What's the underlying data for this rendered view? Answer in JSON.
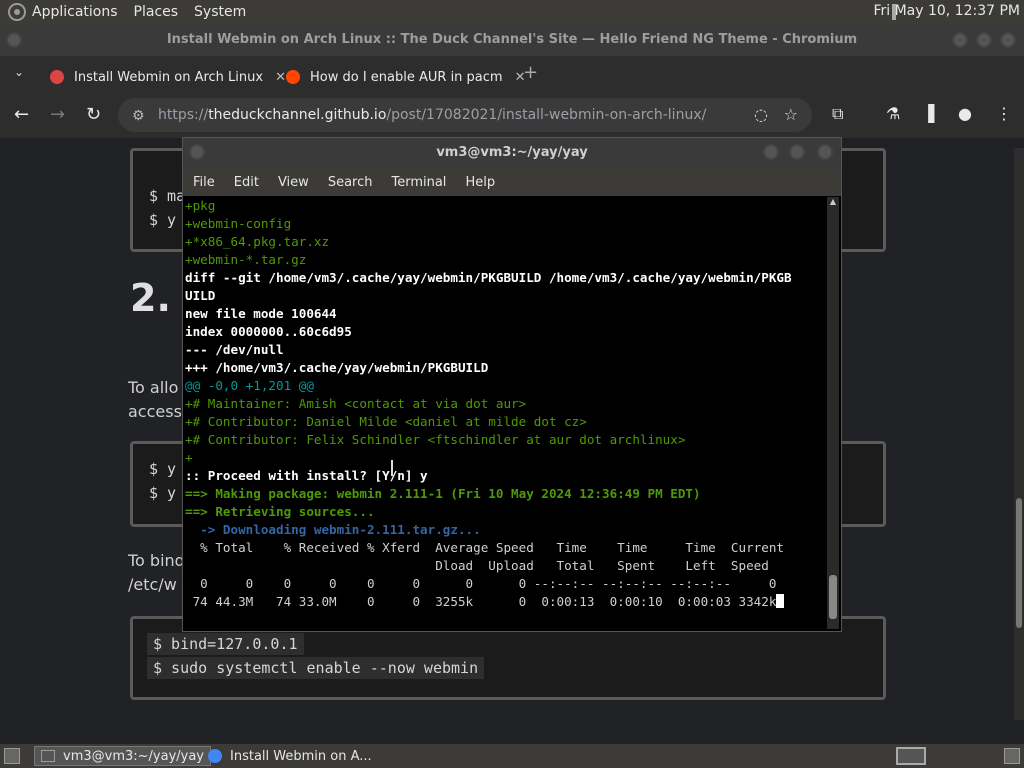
{
  "panel": {
    "menus": [
      "Applications",
      "Places",
      "System"
    ],
    "clock": "Fri May 10, 12:37 PM"
  },
  "browser": {
    "window_title": "Install Webmin on Arch Linux :: The Duck Channel's Site — Hello Friend NG Theme - Chromium",
    "tabs": [
      {
        "label": "Install Webmin on Arch Linux",
        "icon": "duck-favicon"
      },
      {
        "label": "How do I enable AUR in pacm",
        "icon": "reddit-favicon"
      }
    ],
    "url_prefix": "https://",
    "url_host": "theduckchannel.github.io",
    "url_path": "/post/17082021/install-webmin-on-arch-linux/"
  },
  "page": {
    "box1": [
      "$ ma",
      "$ y"
    ],
    "heading": "2.",
    "para1": [
      "To allo",
      "access"
    ],
    "box2": [
      "$ y",
      "$ y"
    ],
    "para2": [
      "To bind",
      "/etc/w"
    ],
    "box3": [
      "$ bind=127.0.0.1",
      "$ sudo systemctl enable --now webmin"
    ]
  },
  "terminal": {
    "title": "vm3@vm3:~/yay/yay",
    "menu": [
      "File",
      "Edit",
      "View",
      "Search",
      "Terminal",
      "Help"
    ],
    "lines": [
      {
        "c": "g",
        "t": "+pkg"
      },
      {
        "c": "g",
        "t": "+webmin-config"
      },
      {
        "c": "g",
        "t": "+*x86_64.pkg.tar.xz"
      },
      {
        "c": "g",
        "t": "+webmin-*.tar.gz"
      },
      {
        "c": "w",
        "t": "diff --git /home/vm3/.cache/yay/webmin/PKGBUILD /home/vm3/.cache/yay/webmin/PKGB"
      },
      {
        "c": "w",
        "t": "UILD"
      },
      {
        "c": "w",
        "t": "new file mode 100644"
      },
      {
        "c": "w",
        "t": "index 0000000..60c6d95"
      },
      {
        "c": "w",
        "t": "--- /dev/null"
      },
      {
        "c": "w",
        "t": "+++ /home/vm3/.cache/yay/webmin/PKGBUILD"
      },
      {
        "c": "c",
        "t": "@@ -0,0 +1,201 @@"
      },
      {
        "c": "g",
        "t": "+# Maintainer: Amish <contact at via dot aur>"
      },
      {
        "c": "g",
        "t": "+# Contributor: Daniel Milde <daniel at milde dot cz>"
      },
      {
        "c": "g",
        "t": "+# Contributor: Felix Schindler <ftschindler at aur dot archlinux>"
      },
      {
        "c": "g",
        "t": "+"
      },
      {
        "c": "w",
        "t": ":: Proceed with install? [Y/n] y"
      },
      {
        "c": "gb",
        "t": "==> Making package: webmin 2.111-1 (Fri 10 May 2024 12:36:49 PM EDT)"
      },
      {
        "c": "gb",
        "t": "==> Retrieving sources..."
      },
      {
        "c": "bb",
        "t": "  -> Downloading webmin-2.111.tar.gz..."
      },
      {
        "c": "t",
        "t": "  % Total    % Received % Xferd  Average Speed   Time    Time     Time  Current"
      },
      {
        "c": "t",
        "t": "                                 Dload  Upload   Total   Spent    Left  Speed"
      },
      {
        "c": "t",
        "t": "  0     0    0     0    0     0      0      0 --:--:-- --:--:-- --:--:--     0"
      },
      {
        "c": "t",
        "t": " 74 44.3M   74 33.0M    0     0  3255k      0  0:00:13  0:00:10  0:00:03 3342k"
      }
    ]
  },
  "taskbar": {
    "items": [
      {
        "label": "vm3@vm3:~/yay/yay",
        "icon": "terminal-icon"
      },
      {
        "label": "Install Webmin on A...",
        "icon": "chromium-icon"
      }
    ]
  }
}
